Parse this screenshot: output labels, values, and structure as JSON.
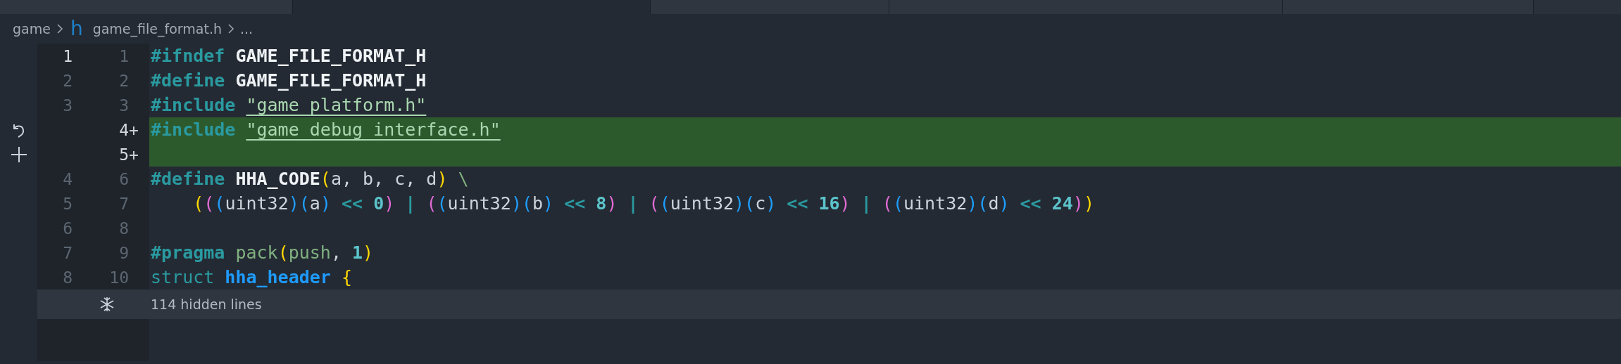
{
  "tabs": [
    {
      "selected": false
    },
    {
      "selected": true
    },
    {
      "selected": false
    },
    {
      "selected": false
    },
    {
      "selected": false
    }
  ],
  "breadcrumb": [
    {
      "kind": "folder",
      "label": "game"
    },
    {
      "kind": "file",
      "icon": "h",
      "label": "game_file_format.h"
    },
    {
      "kind": "more",
      "label": "..."
    }
  ],
  "lines": [
    {
      "kind": "context",
      "old": "1",
      "new": "1",
      "added": false,
      "tokens": [
        {
          "kind": "keyword",
          "text": "#ifndef "
        },
        {
          "kind": "macro",
          "text": "GAME_FILE_FORMAT_H"
        }
      ]
    },
    {
      "kind": "context",
      "old": "2",
      "new": "2",
      "added": false,
      "tokens": [
        {
          "kind": "keyword",
          "text": "#define "
        },
        {
          "kind": "macro",
          "text": "GAME_FILE_FORMAT_H"
        }
      ]
    },
    {
      "kind": "context",
      "old": "3",
      "new": "3",
      "added": false,
      "tokens": [
        {
          "kind": "keyword",
          "text": "#include "
        },
        {
          "kind": "string",
          "text": "\"game_platform.h\""
        }
      ]
    },
    {
      "kind": "revert",
      "new": "4",
      "mark": "+",
      "added": true,
      "tokens": [
        {
          "kind": "keyword",
          "text": "#include "
        },
        {
          "kind": "string",
          "text": "\"game_debug_interface.h\""
        }
      ]
    },
    {
      "kind": "add",
      "new": "5",
      "mark": "+",
      "added": true
    },
    {
      "kind": "context",
      "old": "4",
      "new": "6",
      "added": false,
      "tokens": [
        {
          "kind": "keyword",
          "text": "#define "
        },
        {
          "kind": "macro",
          "text": "HHA_CODE"
        },
        {
          "kind": "paren1",
          "text": "("
        },
        {
          "kind": "plain",
          "text": "a, b, c, d"
        },
        {
          "kind": "paren1",
          "text": ")"
        },
        {
          "kind": "escape",
          "text": " \\"
        }
      ]
    },
    {
      "kind": "context",
      "old": "5",
      "new": "7",
      "added": false,
      "tokens": [
        {
          "kind": "paren1",
          "text": "    ("
        },
        {
          "kind": "paren2",
          "text": "("
        },
        {
          "kind": "paren3",
          "text": "("
        },
        {
          "kind": "plain",
          "text": "uint32"
        },
        {
          "kind": "paren3",
          "text": ")("
        },
        {
          "kind": "plain",
          "text": "a"
        },
        {
          "kind": "paren3",
          "text": ")"
        },
        {
          "kind": "operator",
          "text": " << "
        },
        {
          "kind": "number",
          "text": "0"
        },
        {
          "kind": "paren2",
          "text": ")"
        },
        {
          "kind": "operator",
          "text": " | "
        },
        {
          "kind": "paren2",
          "text": "("
        },
        {
          "kind": "paren3",
          "text": "("
        },
        {
          "kind": "plain",
          "text": "uint32"
        },
        {
          "kind": "paren3",
          "text": ")("
        },
        {
          "kind": "plain",
          "text": "b"
        },
        {
          "kind": "paren3",
          "text": ")"
        },
        {
          "kind": "operator",
          "text": " << "
        },
        {
          "kind": "number",
          "text": "8"
        },
        {
          "kind": "paren2",
          "text": ")"
        },
        {
          "kind": "operator",
          "text": " | "
        },
        {
          "kind": "paren2",
          "text": "("
        },
        {
          "kind": "paren3",
          "text": "("
        },
        {
          "kind": "plain",
          "text": "uint32"
        },
        {
          "kind": "paren3",
          "text": ")("
        },
        {
          "kind": "plain",
          "text": "c"
        },
        {
          "kind": "paren3",
          "text": ")"
        },
        {
          "kind": "operator",
          "text": " << "
        },
        {
          "kind": "number",
          "text": "16"
        },
        {
          "kind": "paren2",
          "text": ")"
        },
        {
          "kind": "operator",
          "text": " | "
        },
        {
          "kind": "paren2",
          "text": "("
        },
        {
          "kind": "paren3",
          "text": "("
        },
        {
          "kind": "plain",
          "text": "uint32"
        },
        {
          "kind": "paren3",
          "text": ")("
        },
        {
          "kind": "plain",
          "text": "d"
        },
        {
          "kind": "paren3",
          "text": ")"
        },
        {
          "kind": "operator",
          "text": " << "
        },
        {
          "kind": "number",
          "text": "24"
        },
        {
          "kind": "paren2",
          "text": ")"
        },
        {
          "kind": "paren1",
          "text": ")"
        }
      ]
    },
    {
      "kind": "context",
      "old": "6",
      "new": "8",
      "added": false
    },
    {
      "kind": "context",
      "old": "7",
      "new": "9",
      "added": false,
      "tokens": [
        {
          "kind": "keyword",
          "text": "#pragma "
        },
        {
          "kind": "func",
          "text": "pack"
        },
        {
          "kind": "paren1",
          "text": "("
        },
        {
          "kind": "func",
          "text": "push"
        },
        {
          "kind": "plain",
          "text": ", "
        },
        {
          "kind": "number",
          "text": "1"
        },
        {
          "kind": "paren1",
          "text": ")"
        }
      ]
    },
    {
      "kind": "context",
      "old": "8",
      "new": "10",
      "added": false,
      "tokens": [
        {
          "kind": "storage",
          "text": "struct "
        },
        {
          "kind": "typename",
          "text": "hha_header"
        },
        {
          "kind": "paren1",
          "text": " {"
        }
      ]
    }
  ],
  "folded": {
    "label": "114 hidden lines"
  }
}
